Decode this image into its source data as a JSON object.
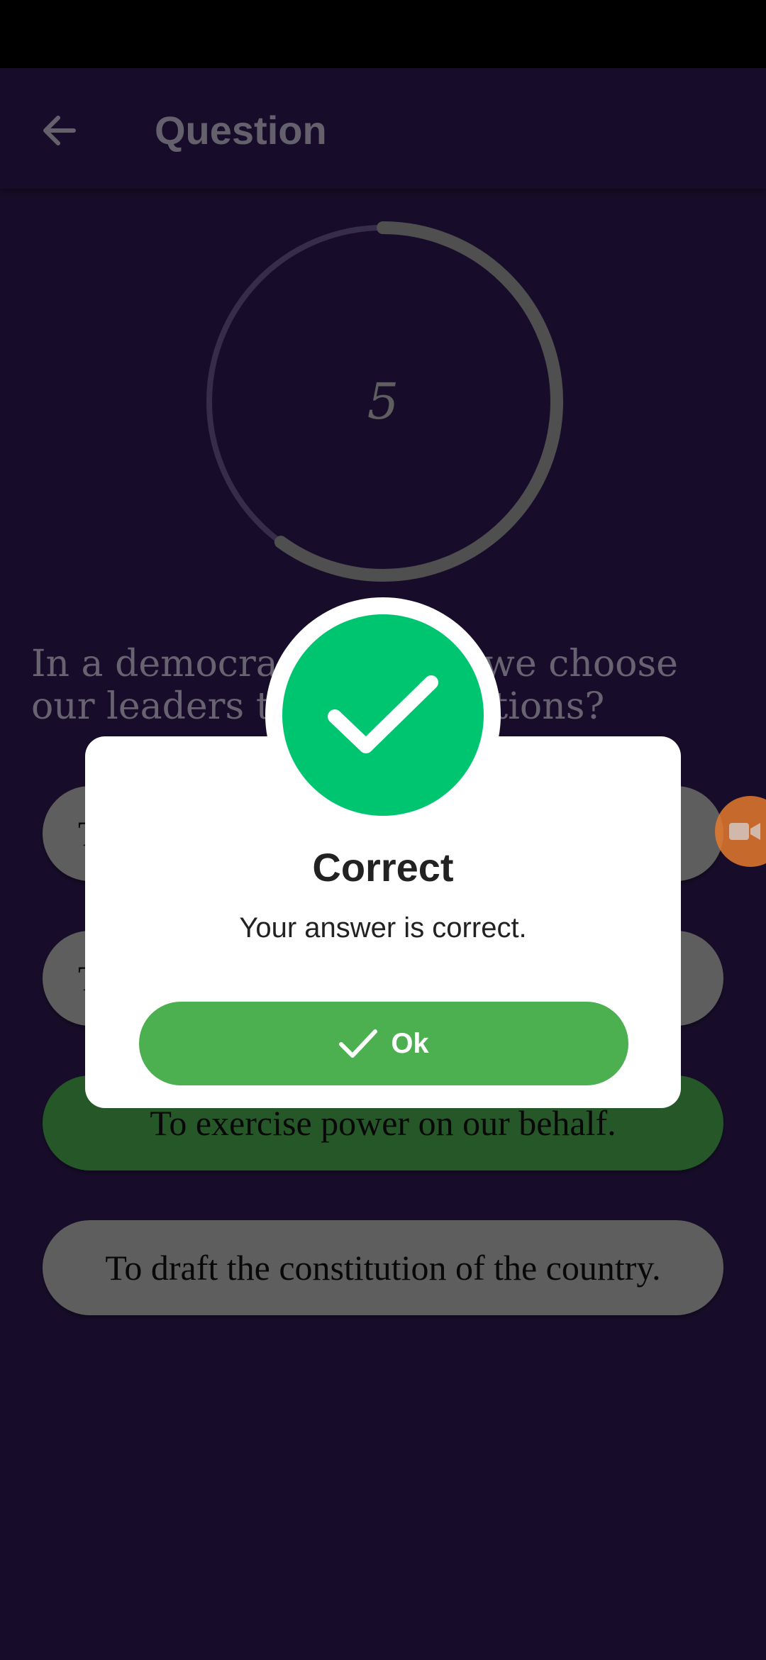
{
  "app_bar": {
    "title": "Question"
  },
  "timer": {
    "value": "5",
    "remaining_fraction": 0.6
  },
  "question": {
    "text": "In a democracy, why do we choose our leaders through elections?"
  },
  "options": [
    {
      "label": "T"
    },
    {
      "label": "T"
    },
    {
      "label": "To exercise power on our behalf.",
      "state": "correct"
    },
    {
      "label": "To draft the constitution of the country."
    }
  ],
  "dialog": {
    "title": "Correct",
    "message": "Your answer is correct.",
    "ok_label": "Ok",
    "icon": "check-icon"
  },
  "colors": {
    "background": "#2f1b54",
    "success": "#00c570",
    "button": "#4caf50",
    "option": "#bdbdbd"
  }
}
